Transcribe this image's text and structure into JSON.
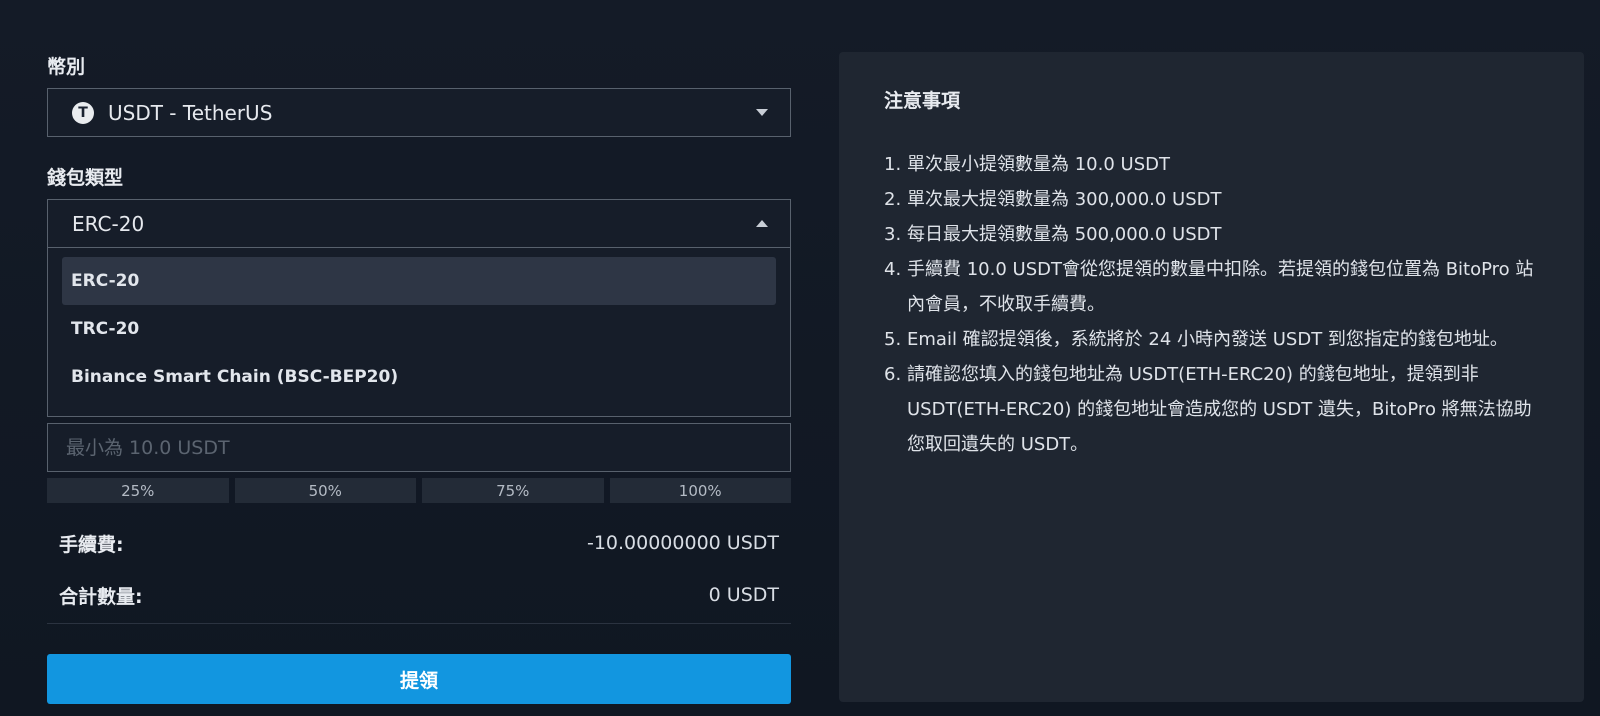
{
  "form": {
    "currency_label": "幣別",
    "currency_value": "USDT - TetherUS",
    "currency_coin_glyph": "T",
    "wallet_label": "錢包類型",
    "wallet_value": "ERC-20",
    "wallet_options": [
      "ERC-20",
      "TRC-20",
      "Binance Smart Chain (BSC-BEP20)"
    ],
    "amount_placeholder": "最小為 10.0 USDT",
    "percents": [
      "25%",
      "50%",
      "75%",
      "100%"
    ],
    "fee_label": "手續費:",
    "fee_value": "-10.00000000 USDT",
    "total_label": "合計數量:",
    "total_value": "0 USDT",
    "submit_label": "提領"
  },
  "notes": {
    "title": "注意事項",
    "items": [
      {
        "n": "1.",
        "text": "單次最小提領數量為 10.0 USDT"
      },
      {
        "n": "2.",
        "text": "單次最大提領數量為 300,000.0 USDT"
      },
      {
        "n": "3.",
        "text": "每日最大提領數量為 500,000.0 USDT"
      },
      {
        "n": "4.",
        "text": "手續費 10.0 USDT會從您提領的數量中扣除。若提領的錢包位置為 BitoPro 站內會員，不收取手續費。"
      },
      {
        "n": "5.",
        "text": "Email 確認提領後，系統將於 24 小時內發送 USDT 到您指定的錢包地址。"
      },
      {
        "n": "6.",
        "text": "請確認您填入的錢包地址為 USDT(ETH-ERC20) 的錢包地址，提領到非 USDT(ETH-ERC20) 的錢包地址會造成您的 USDT 遺失，BitoPro 將無法協助您取回遺失的 USDT。"
      }
    ]
  },
  "colors": {
    "accent": "#1296e0",
    "panel": "#1f2631",
    "background": "#141b27"
  }
}
